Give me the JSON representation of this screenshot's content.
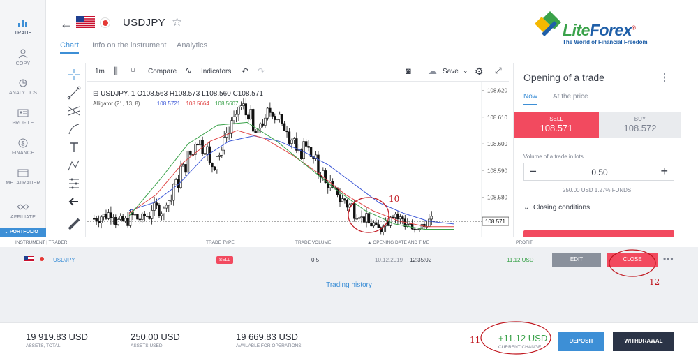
{
  "sidebar": {
    "items": [
      {
        "label": "TRADE",
        "icon": "bar-chart-icon"
      },
      {
        "label": "COPY",
        "icon": "user-copy-icon"
      },
      {
        "label": "ANALYTICS",
        "icon": "analytics-icon"
      },
      {
        "label": "PROFILE",
        "icon": "profile-card-icon"
      },
      {
        "label": "FINANCE",
        "icon": "dollar-coin-icon"
      },
      {
        "label": "METATRADER",
        "icon": "window-icon"
      },
      {
        "label": "AFFILIATE",
        "icon": "handshake-icon"
      }
    ],
    "portfolio": "PORTFOLIO"
  },
  "header": {
    "symbol": "USDJPY",
    "tabs": [
      "Chart",
      "Info on the instrument",
      "Analytics"
    ]
  },
  "logo": {
    "name_part1": "Lite",
    "name_part2": "Forex",
    "registered": "®",
    "tagline": "The World of Financial Freedom"
  },
  "toolbar": {
    "interval": "1m",
    "compare": "Compare",
    "indicators": "Indicators",
    "save": "Save"
  },
  "chart": {
    "ohlc": "USDJPY, 1    O108.563  H108.573  L108.560  C108.571",
    "indicator": "Alligator (21, 13, 8)",
    "alligator_values": [
      "108.5721",
      "108.5664",
      "108.5607"
    ]
  },
  "chart_data": {
    "type": "candlestick",
    "symbol": "USDJPY",
    "interval": "1",
    "y_ticks": [
      "108.620",
      "108.610",
      "108.600",
      "108.590",
      "108.580",
      "108.571"
    ],
    "last_price": "108.571",
    "ylim": [
      108.565,
      108.623
    ],
    "candles": [
      108.572,
      108.573,
      108.574,
      108.571,
      108.571,
      108.573,
      108.572,
      108.573,
      108.576,
      108.575,
      108.579,
      108.585,
      108.591,
      108.596,
      108.601,
      108.598,
      108.592,
      108.596,
      108.604,
      108.609,
      108.614,
      108.611,
      108.604,
      108.608,
      108.612,
      108.61,
      108.606,
      108.602,
      108.596,
      108.6,
      108.594,
      108.589,
      108.585,
      108.582,
      108.579,
      108.577,
      108.574,
      108.572,
      108.57,
      108.568,
      108.571,
      108.574,
      108.572,
      108.57,
      108.567,
      108.569,
      108.571
    ],
    "alligator": {
      "jaw": {
        "color": "#3e5ad8",
        "values": [
          108.575,
          108.578,
          108.585,
          108.595,
          108.601,
          108.603,
          108.601,
          108.597,
          108.592,
          108.585,
          108.578,
          108.574,
          108.571,
          108.57
        ]
      },
      "teeth": {
        "color": "#e04545",
        "values": [
          108.574,
          108.581,
          108.593,
          108.601,
          108.605,
          108.602,
          108.596,
          108.589,
          108.581,
          108.575,
          108.571,
          108.569,
          108.569
        ]
      },
      "lips": {
        "color": "#3aa24a",
        "values": [
          108.573,
          108.586,
          108.6,
          108.607,
          108.608,
          108.601,
          108.592,
          108.583,
          108.575,
          108.57,
          108.568,
          108.568
        ]
      }
    }
  },
  "trade_panel": {
    "title": "Opening of a trade",
    "tab_now": "Now",
    "tab_price": "At the price",
    "sell_label": "SELL",
    "sell_price": "108.571",
    "buy_label": "BUY",
    "buy_price": "108.572",
    "volume_label": "Volume of a trade in lots",
    "volume_value": "0.50",
    "minus": "−",
    "plus": "+",
    "volume_info": "250.00 USD  1.27% FUNDS",
    "closing_conditions": "Closing conditions"
  },
  "positions": {
    "headers": [
      "INSTRUMENT | TRADER",
      "TRADE TYPE",
      "TRADE VOLUME",
      "▲ OPENING DATE AND TIME",
      "PROFIT"
    ],
    "row": {
      "symbol": "USDJPY",
      "type": "SELL",
      "volume": "0.5",
      "date": "10.12.2019",
      "time": "12:35:02",
      "profit": "11.12 USD",
      "edit": "EDIT",
      "close": "CLOSE",
      "more": "•••"
    },
    "history_link": "Trading history"
  },
  "footer": {
    "assets_total": {
      "value": "19 919.83 USD",
      "label": "ASSETS, TOTAL"
    },
    "assets_used": {
      "value": "250.00 USD",
      "label": "ASSETS USED"
    },
    "available": {
      "value": "19 669.83 USD",
      "label": "AVAILABLE FOR OPERATIONS"
    },
    "change": {
      "value": "+11.12 USD",
      "label": "CURRENT CHANGE"
    },
    "deposit": "DEPOSIT",
    "withdrawal": "WITHDRAWAL"
  },
  "annotations": [
    "10",
    "11",
    "12"
  ],
  "colors": {
    "accent": "#3d8fd6",
    "sell": "#f24a5f",
    "profit": "#3aa24a",
    "annotation": "#c0161e"
  }
}
